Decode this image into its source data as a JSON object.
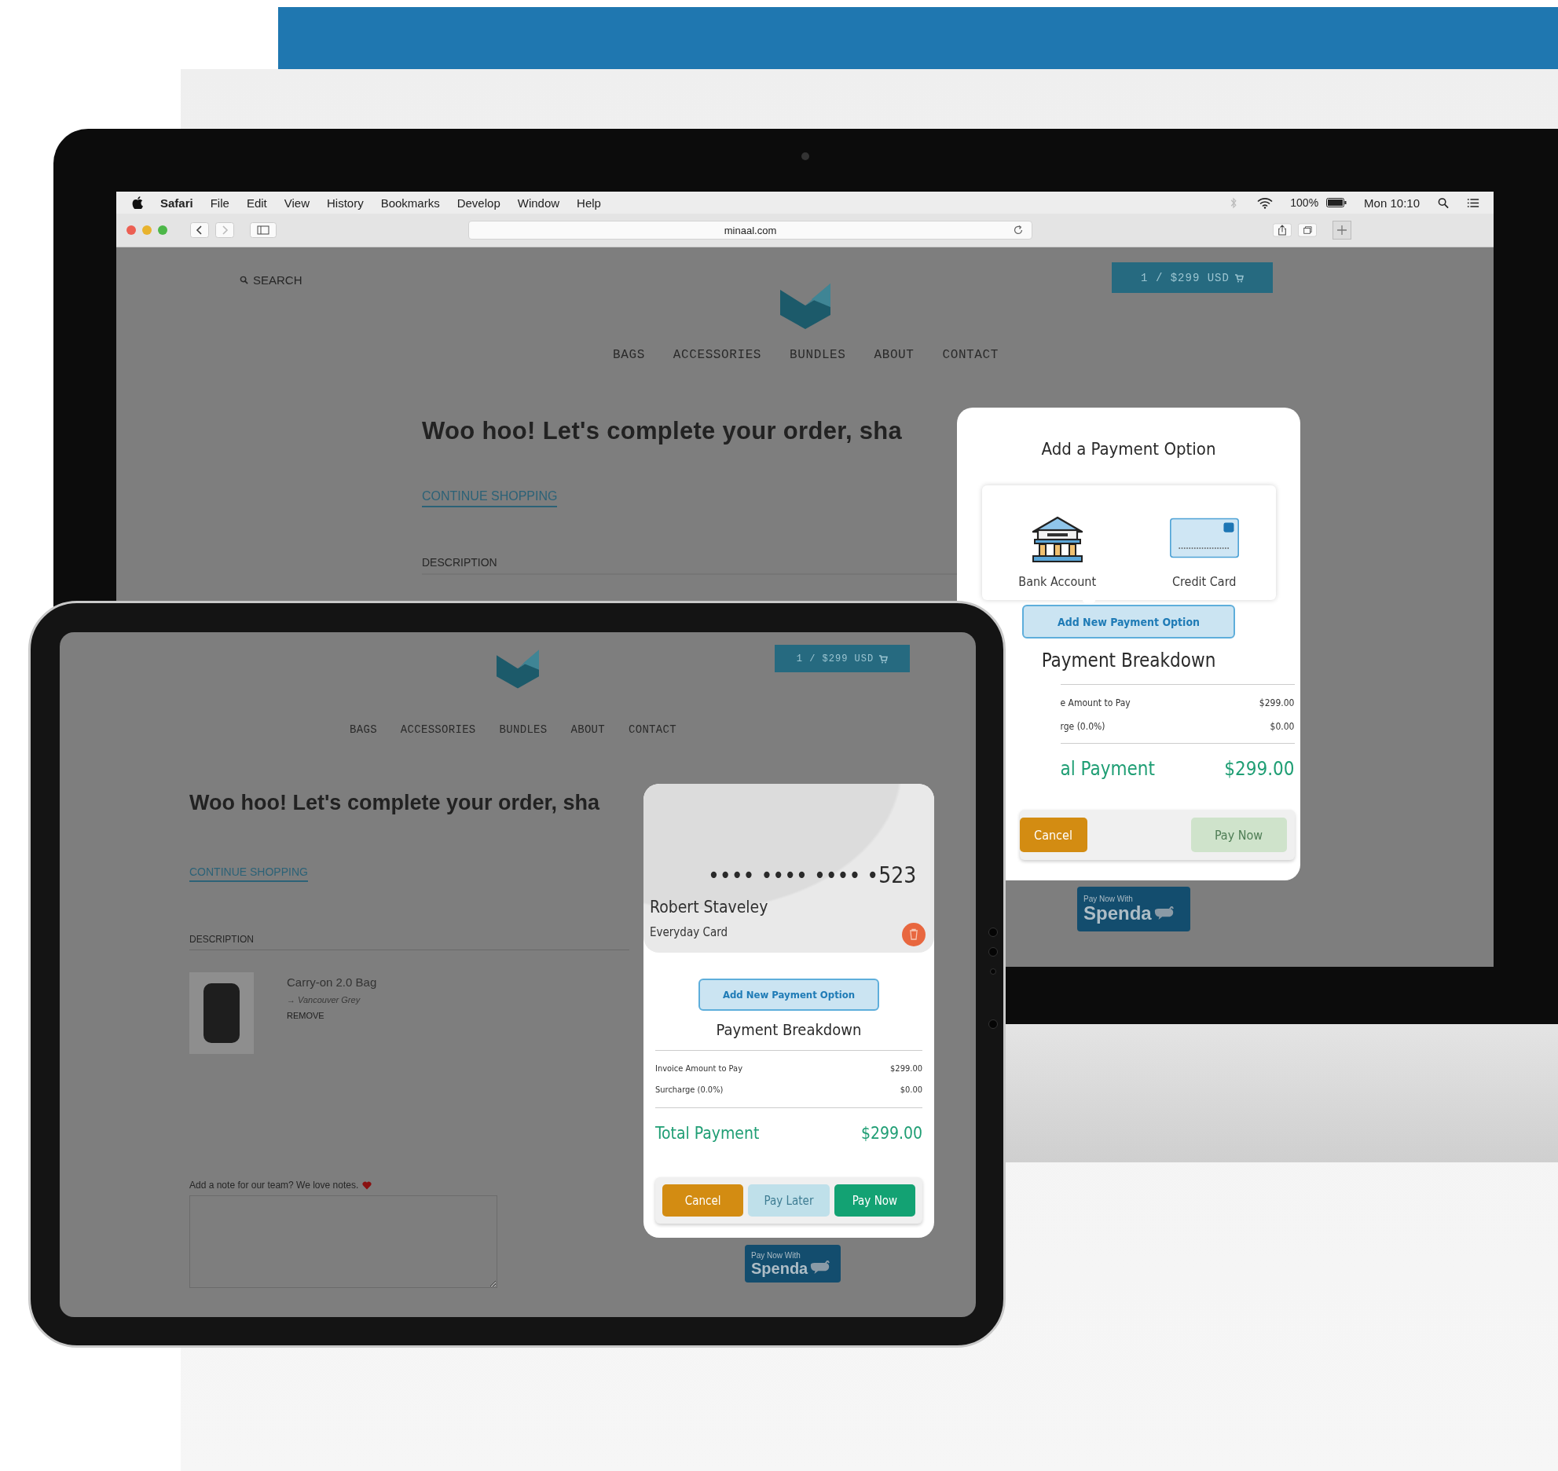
{
  "desktop": {
    "menu_bar": {
      "app": "Safari",
      "items": [
        "File",
        "Edit",
        "View",
        "History",
        "Bookmarks",
        "Develop",
        "Window",
        "Help"
      ],
      "battery": "100%",
      "clock": "Mon 10:10"
    },
    "browser": {
      "url": "minaal.com"
    },
    "page": {
      "search": "SEARCH",
      "cart": "1 / $299 USD",
      "nav": [
        "BAGS",
        "ACCESSORIES",
        "BUNDLES",
        "ABOUT",
        "CONTACT"
      ],
      "heading": "Woo hoo! Let's complete your order, sha",
      "continue_link": "CONTINUE SHOPPING",
      "column_header": "DESCRIPTION"
    },
    "modal": {
      "title": "Add a Payment Option",
      "options": [
        {
          "kind": "bank",
          "label": "Bank Account"
        },
        {
          "kind": "card",
          "label": "Credit Card"
        }
      ],
      "add_button": "Add New Payment Option",
      "breakdown_title": "Payment Breakdown",
      "rows": [
        {
          "label": "e Amount to Pay",
          "value": "$299.00"
        },
        {
          "label": "rge (0.0%)",
          "value": "$0.00"
        }
      ],
      "total": {
        "label": "al Payment",
        "value": "$299.00"
      },
      "buttons": [
        {
          "kind": "cancel",
          "label": "Cancel",
          "disabled": false
        },
        {
          "kind": "pay_now",
          "label": "Pay Now",
          "disabled": true
        }
      ]
    },
    "badge": {
      "caption": "Pay Now With",
      "brand": "Spenda"
    }
  },
  "tablet": {
    "page": {
      "cart": "1 / $299 USD",
      "nav": [
        "BAGS",
        "ACCESSORIES",
        "BUNDLES",
        "ABOUT",
        "CONTACT"
      ],
      "heading": "Woo hoo! Let's complete your order, sha",
      "continue_link": "CONTINUE SHOPPING",
      "column_header": "DESCRIPTION",
      "items": [
        {
          "name": "Carry-on 2.0 Bag",
          "variant": "→ Vancouver Grey",
          "remove": "REMOVE"
        }
      ],
      "note_label": "Add a note for our team? We love notes."
    },
    "modal": {
      "card": {
        "number": "•••• •••• •••• •523",
        "holder": "Robert Staveley",
        "nickname": "Everyday Card"
      },
      "add_button": "Add New Payment Option",
      "breakdown_title": "Payment Breakdown",
      "rows": [
        {
          "label": "Invoice Amount to Pay",
          "value": "$299.00"
        },
        {
          "label": "Surcharge (0.0%)",
          "value": "$0.00"
        }
      ],
      "total": {
        "label": "Total Payment",
        "value": "$299.00"
      },
      "buttons": [
        {
          "kind": "cancel",
          "label": "Cancel",
          "disabled": false
        },
        {
          "kind": "pay_later",
          "label": "Pay Later",
          "disabled": true
        },
        {
          "kind": "pay_now",
          "label": "Pay Now",
          "disabled": false
        }
      ]
    },
    "badge": {
      "caption": "Pay Now With",
      "brand": "Spenda"
    }
  }
}
